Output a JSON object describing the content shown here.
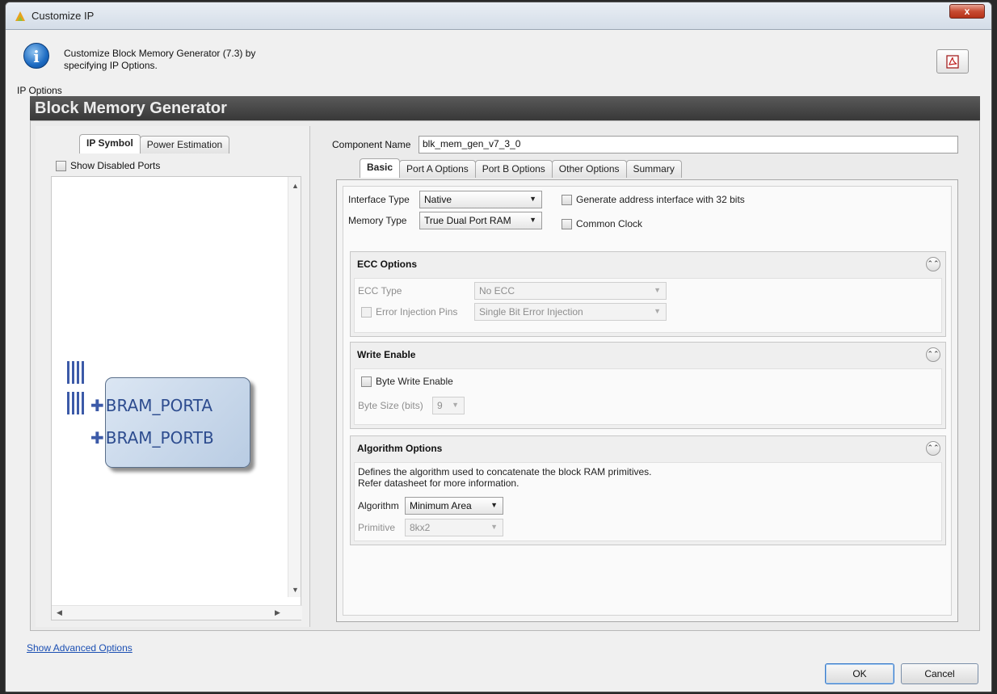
{
  "window": {
    "title": "Customize IP",
    "close_label": "x"
  },
  "info": {
    "line1": "Customize Block Memory Generator (7.3) by",
    "line2": "specifying IP Options."
  },
  "ip_options_label": "IP Options",
  "header_title": "Block Memory Generator",
  "left_panel": {
    "tabs": [
      "IP Symbol",
      "Power Estimation"
    ],
    "active_tab": "IP Symbol",
    "show_disabled_ports": "Show Disabled Ports",
    "ports": [
      "BRAM_PORTA",
      "BRAM_PORTB"
    ]
  },
  "component": {
    "label": "Component Name",
    "value": "blk_mem_gen_v7_3_0"
  },
  "tabs": [
    "Basic",
    "Port A Options",
    "Port B Options",
    "Other Options",
    "Summary"
  ],
  "active_tab": "Basic",
  "basic": {
    "interface_type_label": "Interface Type",
    "interface_type_value": "Native",
    "memory_type_label": "Memory Type",
    "memory_type_value": "True Dual Port RAM",
    "gen_addr_label": "Generate address interface with 32 bits",
    "common_clock_label": "Common Clock"
  },
  "ecc": {
    "title": "ECC Options",
    "ecc_type_label": "ECC Type",
    "ecc_type_value": "No ECC",
    "error_injection_label": "Error Injection Pins",
    "error_injection_value": "Single Bit Error Injection"
  },
  "write_enable": {
    "title": "Write Enable",
    "byte_write_label": "Byte Write Enable",
    "byte_size_label": "Byte Size (bits)",
    "byte_size_value": "9"
  },
  "algorithm": {
    "title": "Algorithm Options",
    "desc1": "Defines the algorithm used to concatenate the block RAM primitives.",
    "desc2": "Refer datasheet for more information.",
    "algorithm_label": "Algorithm",
    "algorithm_value": "Minimum Area",
    "primitive_label": "Primitive",
    "primitive_value": "8kx2"
  },
  "footer": {
    "advanced_link": "Show Advanced Options",
    "ok": "OK",
    "cancel": "Cancel"
  }
}
